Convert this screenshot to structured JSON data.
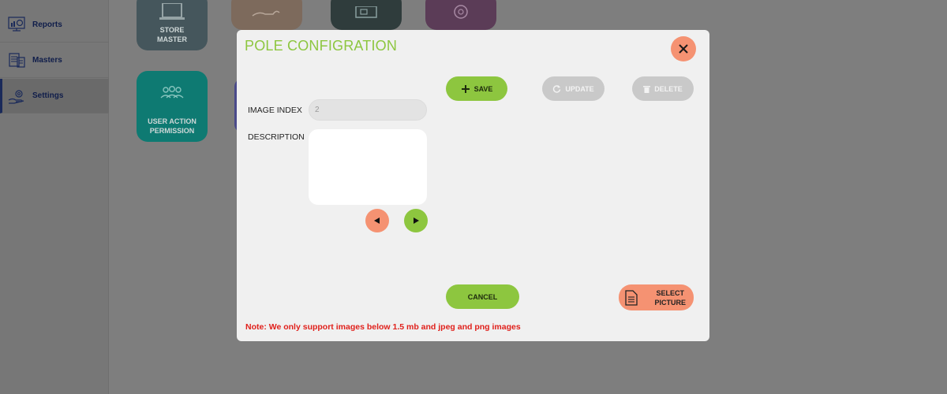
{
  "sidebar": {
    "items": [
      {
        "label": "Reports",
        "icon": "reports-icon"
      },
      {
        "label": "Masters",
        "icon": "masters-icon"
      },
      {
        "label": "Settings",
        "icon": "settings-icon",
        "active": true
      }
    ]
  },
  "tiles": [
    {
      "label_line1": "STORE",
      "label_line2": "MASTER",
      "color": "#45565c"
    },
    {
      "label_line1": "",
      "label_line2": "",
      "color": "#7d6a5c"
    },
    {
      "label_line1": "",
      "label_line2": "",
      "color": "#2f3c3c"
    },
    {
      "label_line1": "",
      "label_line2": "",
      "color": "#5b3c57"
    },
    {
      "label_line1": "USER ACTION",
      "label_line2": "PERMISSION",
      "color": "#0e7a72"
    }
  ],
  "dialog": {
    "title": "POLE CONFIGRATION",
    "image_index_label": "IMAGE INDEX",
    "image_index_value": "2",
    "description_label": "DESCRIPTION",
    "description_value": "",
    "save_label": "SAVE",
    "update_label": "UPDATE",
    "delete_label": "DELETE",
    "cancel_label": "CANCEL",
    "select_picture_line1": "SELECT",
    "select_picture_line2": "PICTURE",
    "note": "Note: We only support images below 1.5 mb and jpeg and png images"
  },
  "colors": {
    "accent_green": "#8dc63f",
    "accent_orange": "#f59272",
    "note_red": "#e0201b",
    "disabled_gray": "#c9c9c9"
  }
}
